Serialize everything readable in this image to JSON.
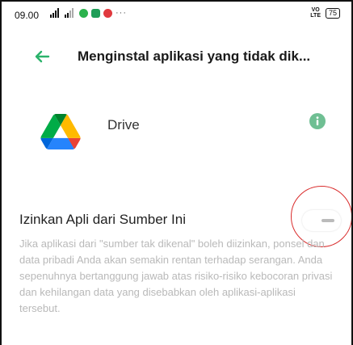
{
  "status_bar": {
    "time": "09.00",
    "more": "···",
    "volte_top": "VO",
    "volte_bottom": "LTE",
    "battery": "75",
    "app_icon_colors": [
      "#2bb24c",
      "#1f9e58",
      "#e0393e"
    ]
  },
  "header": {
    "title": "Menginstal aplikasi yang tidak dik..."
  },
  "app": {
    "name": "Drive"
  },
  "setting": {
    "label": "Izinkan Apli dari Sumber Ini",
    "toggle_on": false
  },
  "description": "Jika aplikasi dari \"sumber tak dikenal\" boleh diizinkan, ponsel dan data pribadi Anda akan semakin rentan terhadap serangan. Anda sepenuhnya bertanggung jawab atas risiko-risiko kebocoran privasi dan kehilangan data yang disebabkan oleh aplikasi-aplikasi tersebut.",
  "colors": {
    "accent": "#2bb36b",
    "annotation": "#d92b2b",
    "description_text": "#b9b9b9"
  }
}
